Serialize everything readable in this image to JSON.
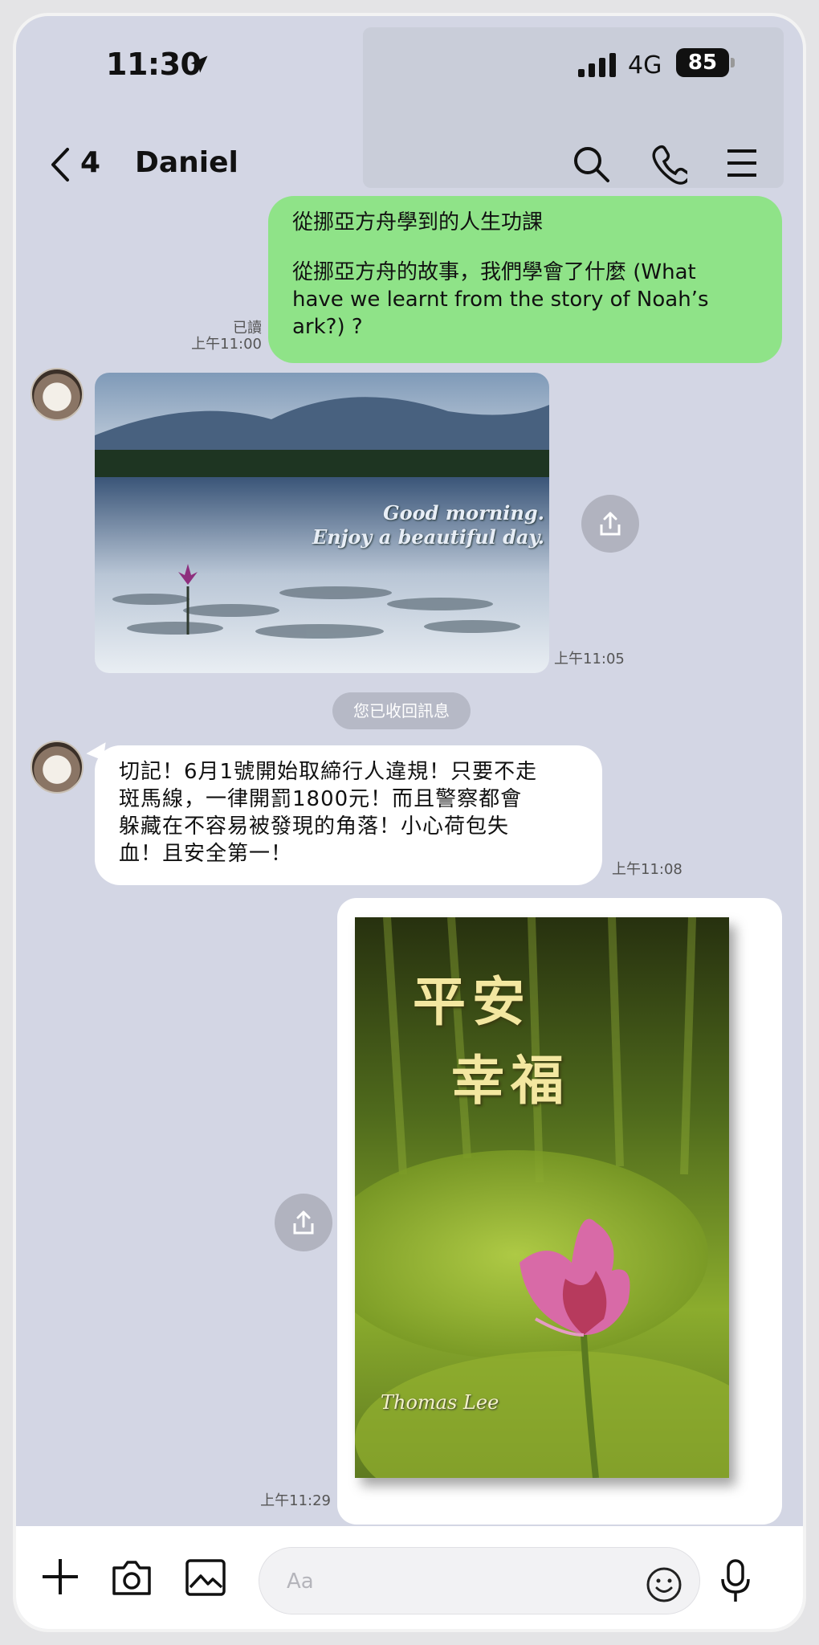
{
  "status_bar": {
    "time": "11:30",
    "network": "4G",
    "battery": "85"
  },
  "header": {
    "back_count": "4",
    "title": "Daniel"
  },
  "messages": {
    "m1": {
      "line1": "從挪亞方舟學到的人生功課",
      "line2": "從挪亞方舟的故事，我們學會了什麼 (What",
      "line3": "have we learnt from the story of Noah’s",
      "line4": "ark?) ?",
      "read": "已讀",
      "time": "上午11:00"
    },
    "m2": {
      "caption1": "Good morning.",
      "caption2": "Enjoy a beautiful day.",
      "time": "上午11:05"
    },
    "system": {
      "text": "您已收回訊息"
    },
    "m3": {
      "line1": "切記！6月1號開始取締行人違規！只要不走",
      "line2": "斑馬線，一律開罰1800元！而且警察都會",
      "line3": "躲藏在不容易被發現的角落！小心荷包失",
      "line4": "血！且安全第一！",
      "time": "上午11:08"
    },
    "m4": {
      "text1": "平安",
      "text2": "幸福",
      "signature": "Thomas Lee",
      "time": "上午11:29"
    }
  },
  "composer": {
    "placeholder": "Aa"
  },
  "icons": {
    "location": "location-arrow-icon",
    "signal": "signal-bars-icon",
    "back": "chevron-left-icon",
    "search": "search-icon",
    "call": "phone-icon",
    "menu": "hamburger-menu-icon",
    "share": "share-icon",
    "plus": "plus-icon",
    "camera": "camera-icon",
    "image": "image-icon",
    "emoji": "emoji-icon",
    "mic": "microphone-icon"
  },
  "colors": {
    "background": "#d3d6e4",
    "sent_bubble": "#8fe388",
    "received_bubble": "#ffffff"
  }
}
